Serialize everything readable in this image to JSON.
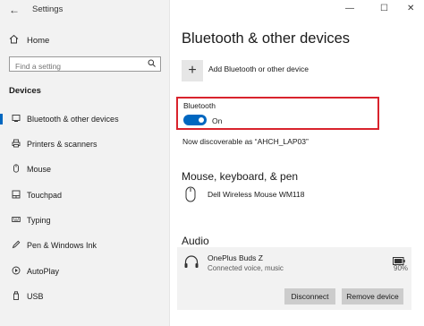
{
  "window": {
    "title": "Settings",
    "minimize": "—",
    "maximize": "☐",
    "close": "✕"
  },
  "sidebar": {
    "home_label": "Home",
    "search_placeholder": "Find a setting",
    "section": "Devices",
    "items": [
      {
        "label": "Bluetooth & other devices",
        "icon": "bluetooth-icon",
        "active": true
      },
      {
        "label": "Printers & scanners",
        "icon": "printer-icon"
      },
      {
        "label": "Mouse",
        "icon": "mouse-icon"
      },
      {
        "label": "Touchpad",
        "icon": "touchpad-icon"
      },
      {
        "label": "Typing",
        "icon": "keyboard-icon"
      },
      {
        "label": "Pen & Windows Ink",
        "icon": "pen-icon"
      },
      {
        "label": "AutoPlay",
        "icon": "autoplay-icon"
      },
      {
        "label": "USB",
        "icon": "usb-icon"
      }
    ]
  },
  "main": {
    "title": "Bluetooth & other devices",
    "add_device_label": "Add Bluetooth or other device",
    "bluetooth": {
      "label": "Bluetooth",
      "state": "On",
      "on": true,
      "discoverable": "Now discoverable as “AHCH_LAP03”"
    },
    "mouse_section": {
      "title": "Mouse, keyboard, & pen",
      "device": "Dell Wireless Mouse WM118"
    },
    "audio_section": {
      "title": "Audio",
      "device": "OnePlus Buds Z",
      "status": "Connected voice, music",
      "battery": "90%",
      "disconnect_label": "Disconnect",
      "remove_label": "Remove device"
    }
  },
  "colors": {
    "accent": "#0067c0",
    "highlight_border": "#d9232d",
    "sidebar_bg": "#f2f2f2"
  }
}
